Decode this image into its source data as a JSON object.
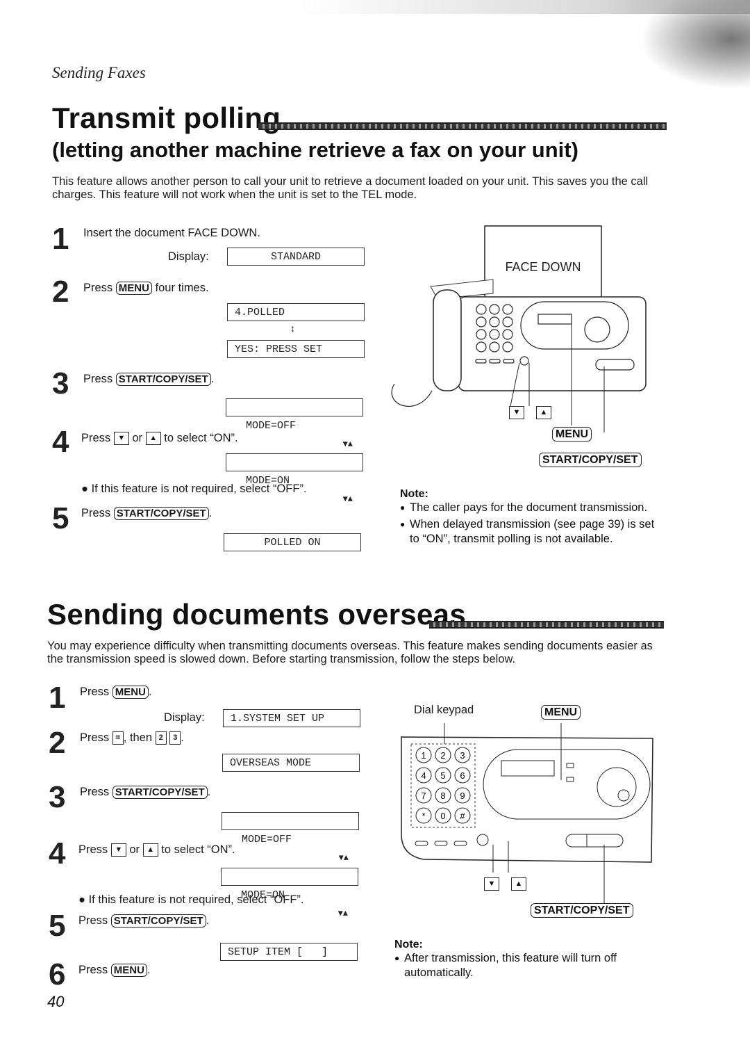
{
  "header": {
    "section": "Sending Faxes"
  },
  "transmit_polling": {
    "title": "Transmit polling",
    "subtitle": "(letting another machine retrieve a fax on your unit)",
    "intro": "This feature allows another person to call your unit to retrieve a document loaded on your unit. This saves you the call charges. This feature will not work when the unit is set to the TEL mode.",
    "steps": [
      {
        "num": "1",
        "text": "Insert the document FACE DOWN.",
        "display_label": "Display:",
        "display": "STANDARD"
      },
      {
        "num": "2",
        "pre": "Press",
        "key": "MENU",
        "post": "four times.",
        "display_a": "4.POLLED",
        "arrow": "↕",
        "display_b": "YES: PRESS SET"
      },
      {
        "num": "3",
        "pre": "Press",
        "key": "START/COPY/SET",
        "post": ".",
        "display": "MODE=OFF",
        "display_icons": "▼▲"
      },
      {
        "num": "4",
        "pre": "Press",
        "key_down": "▼",
        "mid": "or",
        "key_up": "▲",
        "post": "to select “ON”.",
        "display": "MODE=ON",
        "display_icons": "▼▲",
        "bullet": "If this feature is not required, select “OFF”."
      },
      {
        "num": "5",
        "pre": "Press",
        "key": "START/COPY/SET",
        "post": ".",
        "display": "POLLED ON"
      }
    ],
    "figure": {
      "paper_label": "FACE DOWN",
      "down_key": "▼",
      "up_key": "▲",
      "menu_label": "MENU",
      "start_label": "START/COPY/SET"
    },
    "note": {
      "title": "Note:",
      "items": [
        "The caller pays for the document transmission.",
        "When delayed transmission (see page 39) is set to “ON”, transmit polling is not available."
      ]
    }
  },
  "overseas": {
    "title": "Sending documents overseas",
    "intro": "You may experience difficulty when transmitting documents overseas. This feature makes sending documents easier as the transmission speed is slowed down. Before starting transmission, follow the steps below.",
    "steps": [
      {
        "num": "1",
        "pre": "Press",
        "key": "MENU",
        "post": ".",
        "display_label": "Display:",
        "display": "1.SYSTEM SET UP"
      },
      {
        "num": "2",
        "pre": "Press",
        "key_hash": "⌗",
        "mid": ", then",
        "key_2": "2",
        "key_3": "3",
        "post": ".",
        "display": "OVERSEAS MODE"
      },
      {
        "num": "3",
        "pre": "Press",
        "key": "START/COPY/SET",
        "post": ".",
        "display": "MODE=OFF",
        "display_icons": "▼▲"
      },
      {
        "num": "4",
        "pre": "Press",
        "key_down": "▼",
        "mid": "or",
        "key_up": "▲",
        "post": "to select “ON”.",
        "display": "MODE=ON",
        "display_icons": "▼▲",
        "bullet": "If this feature is not required, select “OFF”."
      },
      {
        "num": "5",
        "pre": "Press",
        "key": "START/COPY/SET",
        "post": ".",
        "display": "SETUP ITEM [   ]"
      },
      {
        "num": "6",
        "pre": "Press",
        "key": "MENU",
        "post": "."
      }
    ],
    "figure": {
      "keypad_label": "Dial keypad",
      "menu_label": "MENU",
      "start_label": "START/COPY/SET",
      "keys": [
        "1",
        "2",
        "3",
        "4",
        "5",
        "6",
        "7",
        "8",
        "9",
        "*",
        "0",
        "#"
      ],
      "down_key": "▼",
      "up_key": "▲"
    },
    "note": {
      "title": "Note:",
      "items": [
        "After transmission, this feature will turn off automatically."
      ]
    }
  },
  "footer": {
    "page_number": "40"
  }
}
